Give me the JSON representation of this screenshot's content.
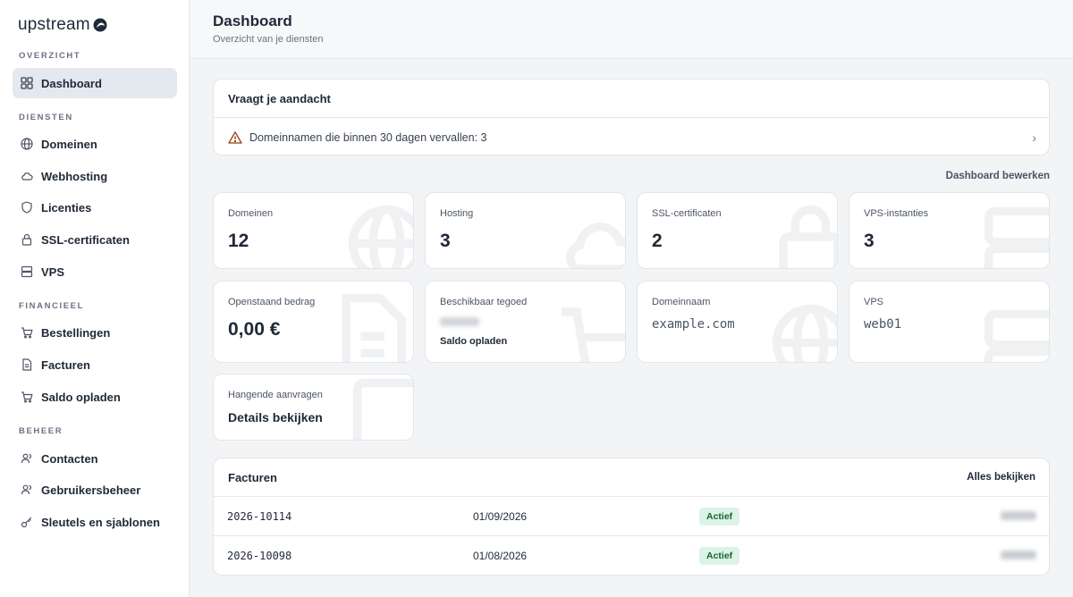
{
  "app": {
    "logo_text": "upstream"
  },
  "sidebar": {
    "sections": [
      {
        "title": "OVERZICHT"
      },
      {
        "title": "DIENSTEN"
      },
      {
        "title": "FINANCIEEL"
      },
      {
        "title": "BEHEER"
      }
    ],
    "items": [
      {
        "label": "Dashboard",
        "icon": "grid-icon",
        "active": true
      },
      {
        "label": "Domeinen",
        "icon": "globe-icon"
      },
      {
        "label": "Webhosting",
        "icon": "cloud-icon"
      },
      {
        "label": "Licenties",
        "icon": "shield-icon"
      },
      {
        "label": "SSL-certificaten",
        "icon": "lock-icon"
      },
      {
        "label": "VPS",
        "icon": "server-icon"
      },
      {
        "label": "Bestellingen",
        "icon": "cart-icon"
      },
      {
        "label": "Facturen",
        "icon": "document-icon"
      },
      {
        "label": "Saldo opladen",
        "icon": "cart-icon"
      },
      {
        "label": "Contacten",
        "icon": "users-icon"
      },
      {
        "label": "Gebruikersbeheer",
        "icon": "users-icon"
      },
      {
        "label": "Sleutels en sjablonen",
        "icon": "key-icon"
      }
    ]
  },
  "header": {
    "title": "Dashboard",
    "subtitle": "Overzicht van je diensten"
  },
  "attention": {
    "title": "Vraagt je aandacht",
    "item": "Domeinnamen die binnen 30 dagen vervallen: 3"
  },
  "edit_dashboard": "Dashboard bewerken",
  "cards": {
    "domains": {
      "label": "Domeinen",
      "value": "12"
    },
    "hosting": {
      "label": "Hosting",
      "value": "3"
    },
    "ssl": {
      "label": "SSL-certificaten",
      "value": "2"
    },
    "vps_instances": {
      "label": "VPS-instanties",
      "value": "3"
    },
    "outstanding": {
      "label": "Openstaand bedrag",
      "value": "0,00 €"
    },
    "balance": {
      "label": "Beschikbaar tegoed",
      "action": "Saldo opladen"
    },
    "domain_name": {
      "label": "Domeinnaam",
      "value": "example.com"
    },
    "vps": {
      "label": "VPS",
      "value": "web01"
    },
    "pending": {
      "label": "Hangende aanvragen",
      "action": "Details bekijken"
    }
  },
  "invoices": {
    "title": "Facturen",
    "view_all": "Alles bekijken",
    "rows": [
      {
        "number": "2026-10114",
        "date": "01/09/2026",
        "status": "Actief"
      },
      {
        "number": "2026-10098",
        "date": "01/08/2026",
        "status": "Actief"
      }
    ]
  },
  "colors": {
    "sidebar_active": "#e4e9f0",
    "badge_bg": "#dcf3e7",
    "badge_text": "#166534",
    "warning": "#b45309"
  }
}
